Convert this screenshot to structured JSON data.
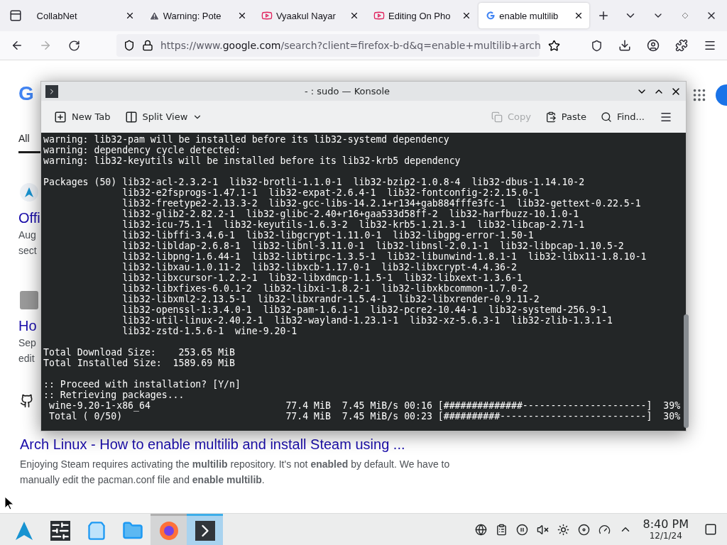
{
  "browser": {
    "tabs": [
      {
        "label": "CollabNet",
        "kind": "plain",
        "selected": false
      },
      {
        "label": "Warning: Pote",
        "kind": "warning",
        "selected": false
      },
      {
        "label": "Vyaakul Nayar",
        "kind": "video",
        "selected": false
      },
      {
        "label": "Editing On Pho",
        "kind": "video",
        "selected": false
      },
      {
        "label": "enable multilib",
        "kind": "google",
        "selected": true
      }
    ],
    "url": {
      "prefix": "https://www.",
      "domain": "google.com",
      "rest": "/search?client=firefox-b-d&q=enable+multilib+arch"
    }
  },
  "page": {
    "logo": "G",
    "filter_tab": {
      "label": "All",
      "selected": true
    },
    "results": [
      {
        "kind": "arch",
        "title": "Offi",
        "lines": [
          "Aug",
          "sect"
        ]
      },
      {
        "kind": "thumb",
        "title": "Ho",
        "lines": [
          "Sep",
          "edit"
        ]
      }
    ],
    "full_result": {
      "kind": "github",
      "title": "Arch Linux - How to enable multilib and install Steam using ...",
      "snippet": "Enjoying Steam requires activating the **multilib** repository. It's not **enabled** by default. We have to manually edit the pacman.conf file and **enable multilib**."
    }
  },
  "konsole": {
    "title": "- : sudo — Konsole",
    "toolbar": [
      {
        "kind": "newtab",
        "label": "New Tab",
        "disabled": false
      },
      {
        "kind": "split",
        "label": "Split View",
        "disabled": false
      },
      {
        "kind": "copy",
        "label": "Copy",
        "disabled": true
      },
      {
        "kind": "paste",
        "label": "Paste",
        "disabled": false
      },
      {
        "kind": "find",
        "label": "Find...",
        "disabled": false
      }
    ],
    "lines": [
      {
        "kind": "text",
        "text": "warning: lib32-pam will be installed before its lib32-systemd dependency"
      },
      {
        "kind": "text",
        "text": "warning: dependency cycle detected:"
      },
      {
        "kind": "text",
        "text": "warning: lib32-keyutils will be installed before its lib32-krb5 dependency"
      },
      {
        "kind": "blank"
      },
      {
        "kind": "text",
        "text": "Packages (50) lib32-acl-2.3.2-1  lib32-brotli-1.1.0-1  lib32-bzip2-1.0.8-4  lib32-dbus-1.14.10-2"
      },
      {
        "kind": "text",
        "text": "              lib32-e2fsprogs-1.47.1-1  lib32-expat-2.6.4-1  lib32-fontconfig-2:2.15.0-1"
      },
      {
        "kind": "text",
        "text": "              lib32-freetype2-2.13.3-2  lib32-gcc-libs-14.2.1+r134+gab884fffe3fc-1  lib32-gettext-0.22.5-1"
      },
      {
        "kind": "text",
        "text": "              lib32-glib2-2.82.2-1  lib32-glibc-2.40+r16+gaa533d58ff-2  lib32-harfbuzz-10.1.0-1"
      },
      {
        "kind": "text",
        "text": "              lib32-icu-75.1-1  lib32-keyutils-1.6.3-2  lib32-krb5-1.21.3-1  lib32-libcap-2.71-1"
      },
      {
        "kind": "text",
        "text": "              lib32-libffi-3.4.6-1  lib32-libgcrypt-1.11.0-1  lib32-libgpg-error-1.50-1"
      },
      {
        "kind": "text",
        "text": "              lib32-libldap-2.6.8-1  lib32-libnl-3.11.0-1  lib32-libnsl-2.0.1-1  lib32-libpcap-1.10.5-2"
      },
      {
        "kind": "text",
        "text": "              lib32-libpng-1.6.44-1  lib32-libtirpc-1.3.5-1  lib32-libunwind-1.8.1-1  lib32-libx11-1.8.10-1"
      },
      {
        "kind": "text",
        "text": "              lib32-libxau-1.0.11-2  lib32-libxcb-1.17.0-1  lib32-libxcrypt-4.4.36-2"
      },
      {
        "kind": "text",
        "text": "              lib32-libxcursor-1.2.2-1  lib32-libxdmcp-1.1.5-1  lib32-libxext-1.3.6-1"
      },
      {
        "kind": "text",
        "text": "              lib32-libxfixes-6.0.1-2  lib32-libxi-1.8.2-1  lib32-libxkbcommon-1.7.0-2"
      },
      {
        "kind": "text",
        "text": "              lib32-libxml2-2.13.5-1  lib32-libxrandr-1.5.4-1  lib32-libxrender-0.9.11-2"
      },
      {
        "kind": "text",
        "text": "              lib32-openssl-1:3.4.0-1  lib32-pam-1.6.1-1  lib32-pcre2-10.44-1  lib32-systemd-256.9-1"
      },
      {
        "kind": "text",
        "text": "              lib32-util-linux-2.40.2-1  lib32-wayland-1.23.1-1  lib32-xz-5.6.3-1  lib32-zlib-1.3.1-1"
      },
      {
        "kind": "text",
        "text": "              lib32-zstd-1.5.6-1  wine-9.20-1"
      },
      {
        "kind": "blank"
      },
      {
        "kind": "text",
        "text": "Total Download Size:    253.65 MiB"
      },
      {
        "kind": "text",
        "text": "Total Installed Size:  1589.69 MiB"
      },
      {
        "kind": "blank"
      },
      {
        "kind": "text",
        "text": ":: Proceed with installation? [Y/n]"
      },
      {
        "kind": "text",
        "text": ":: Retrieving packages..."
      },
      {
        "kind": "text",
        "text": " wine-9.20-1-x86_64                        77.4 MiB  7.45 MiB/s 00:16 [##############----------------------]  39%"
      },
      {
        "kind": "text",
        "text": " Total ( 0/50)                             77.4 MiB  7.45 MiB/s 00:23 [##########--------------------------]  30%"
      }
    ]
  },
  "taskbar": {
    "apps": [
      {
        "kind": "launcher",
        "selected": false
      },
      {
        "kind": "settings",
        "selected": false
      },
      {
        "kind": "store",
        "selected": false
      },
      {
        "kind": "files",
        "selected": false
      },
      {
        "kind": "firefox",
        "selected": false,
        "open": true
      },
      {
        "kind": "terminal",
        "selected": true,
        "open": true
      }
    ],
    "time": "8:40 PM",
    "date": "12/1/24"
  }
}
